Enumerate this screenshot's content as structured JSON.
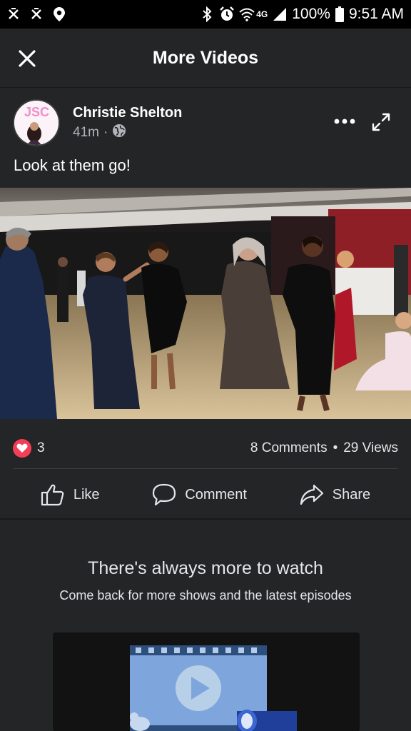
{
  "status_bar": {
    "battery": "100%",
    "time": "9:51 AM",
    "network": "4G",
    "icons": [
      "missed-call-icon",
      "missed-call-icon",
      "location-icon",
      "bluetooth-icon",
      "alarm-icon",
      "wifi-icon",
      "signal-icon",
      "battery-icon"
    ]
  },
  "topbar": {
    "title": "More Videos",
    "close_icon": "close-icon"
  },
  "post": {
    "author": "Christie Shelton",
    "avatar_text": "JSC",
    "time": "41m",
    "separator": "·",
    "privacy_icon": "globe-icon",
    "caption": "Look at them go!",
    "reaction_count": "3",
    "comments": "8 Comments",
    "stats_separator": "•",
    "views": "29 Views",
    "actions": {
      "like": "Like",
      "comment": "Comment",
      "share": "Share"
    }
  },
  "more": {
    "title": "There's always more to watch",
    "subtitle": "Come back for more shows and the latest episodes"
  },
  "colors": {
    "background": "#18191a",
    "card": "#242526",
    "heart": "#f33e58",
    "text": "#e4e6eb",
    "muted": "#b0b3b8"
  }
}
